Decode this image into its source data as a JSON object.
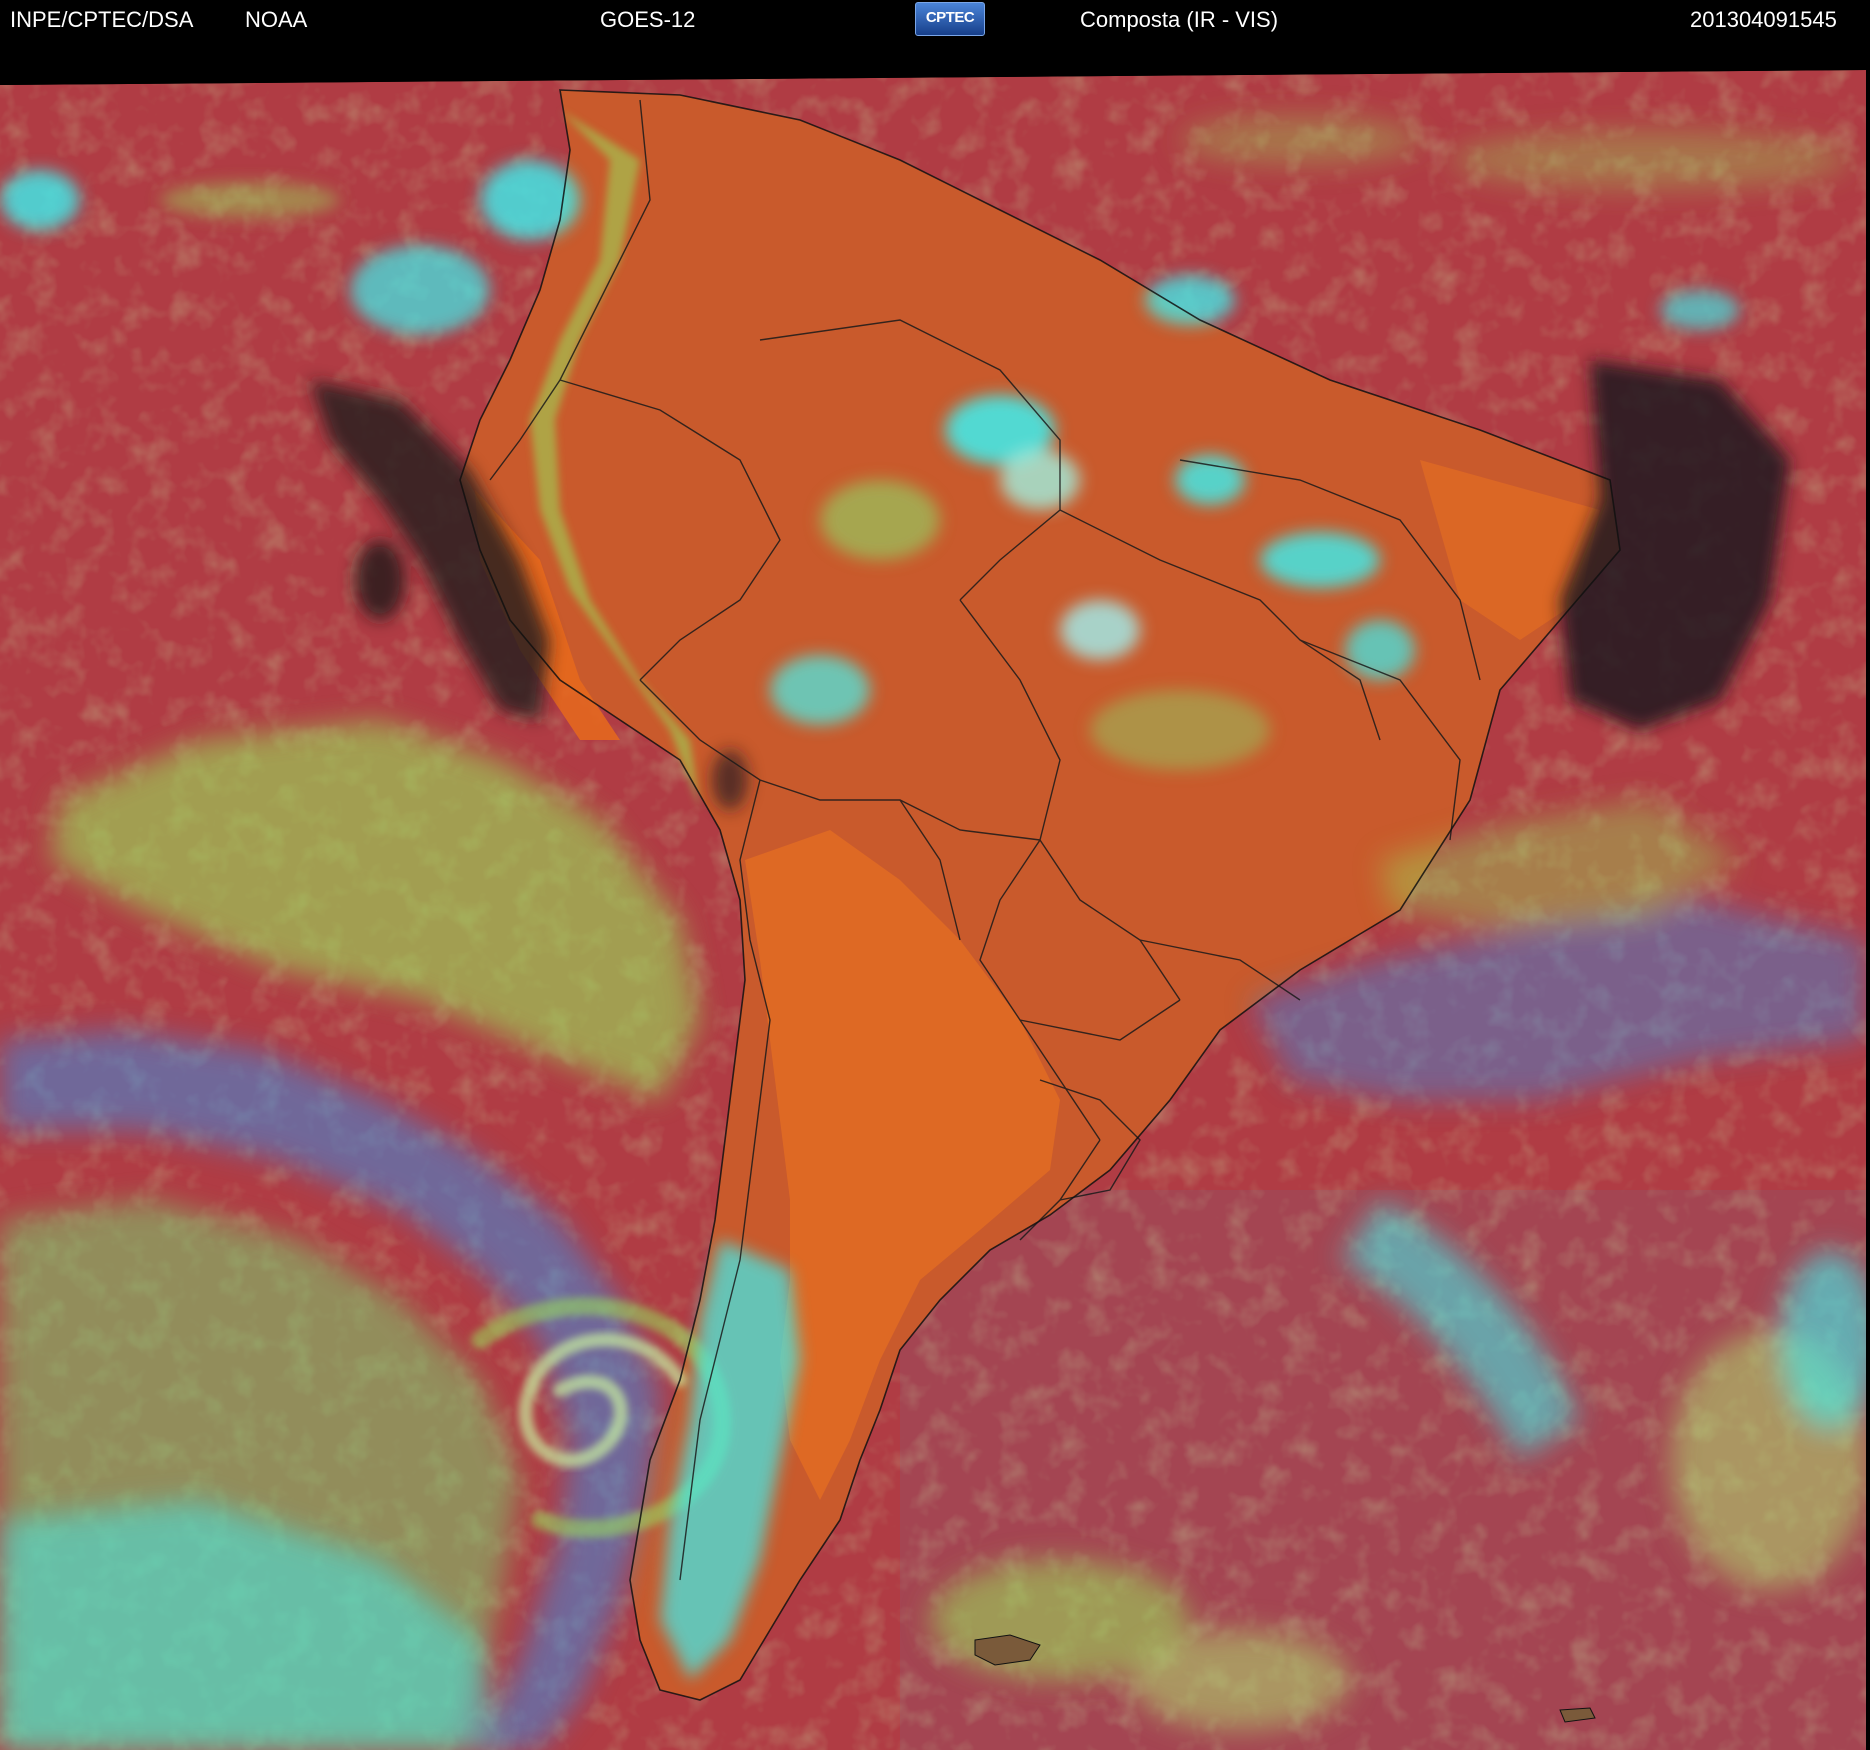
{
  "header": {
    "source": "INPE/CPTEC/DSA",
    "agency": "NOAA",
    "satellite": "GOES-12",
    "logo_text": "CPTEC",
    "product": "Composta (IR - VIS)",
    "timestamp": "201304091545"
  },
  "colors": {
    "ocean_base": "#b03c44",
    "land_base": "#c95a2c",
    "land_dry": "#e86a1c",
    "cloud_cyan": "#3cf0f0",
    "cloud_green": "#9ae05a",
    "cloud_blue": "#3c8ce0",
    "dark_cloud": "#1e1a1c",
    "border_line": "#1a1a1a"
  }
}
